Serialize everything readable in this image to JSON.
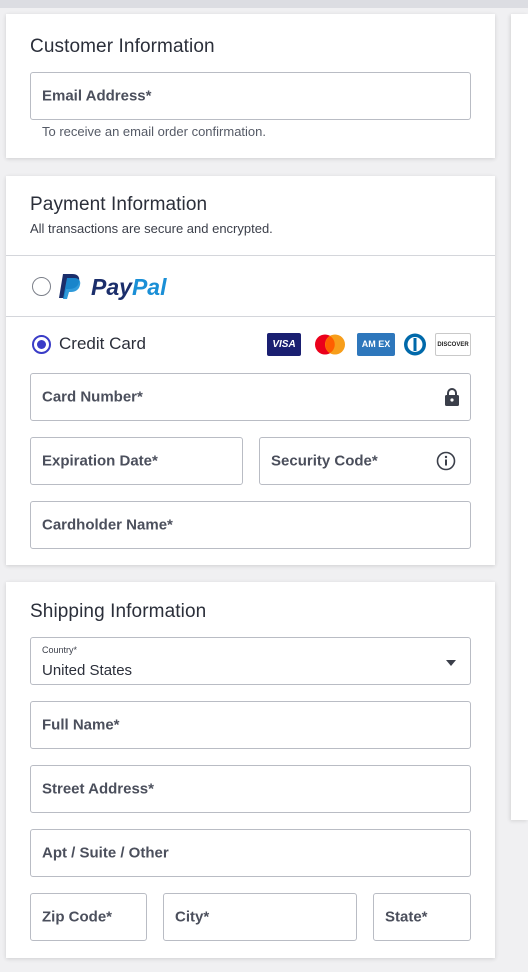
{
  "customer": {
    "title": "Customer Information",
    "email_label": "Email Address*",
    "email_hint": "To receive an email order confirmation."
  },
  "payment": {
    "title": "Payment Information",
    "subtitle": "All transactions are secure and encrypted.",
    "paypal_label_pay": "Pay",
    "paypal_label_pal": "Pal",
    "credit_card_label": "Credit Card",
    "card_logos": [
      "VISA",
      "AM EX",
      "DISCOVER"
    ],
    "card_number_label": "Card Number*",
    "expiration_label": "Expiration Date*",
    "security_code_label": "Security Code*",
    "cardholder_label": "Cardholder Name*",
    "selected_method": "Credit Card"
  },
  "shipping": {
    "title": "Shipping Information",
    "country_label": "Country*",
    "country_value": "United States",
    "full_name_label": "Full Name*",
    "street_label": "Street Address*",
    "apt_label": "Apt / Suite / Other",
    "zip_label": "Zip Code*",
    "city_label": "City*",
    "state_label": "State*"
  },
  "colors": {
    "accent": "#3a3cc7",
    "paypal_dark": "#1b2e6b",
    "paypal_light": "#1a8fd6",
    "visa": "#1a1f71",
    "amex": "#2e77bc",
    "diners": "#0069aa",
    "mc_red": "#eb001b",
    "mc_orange": "#f79e1b"
  }
}
